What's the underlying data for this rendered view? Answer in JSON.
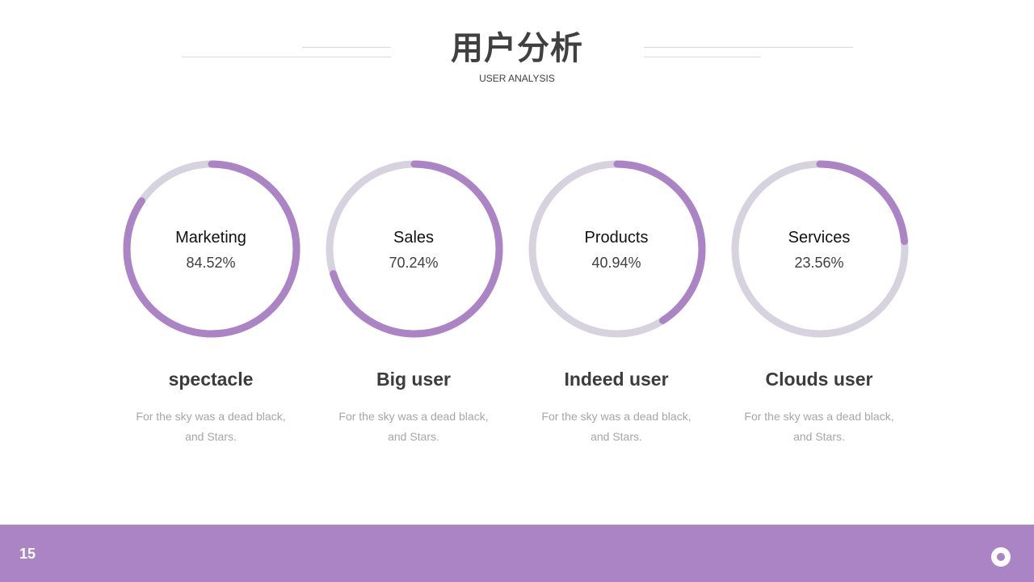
{
  "header": {
    "title": "用户分析",
    "subtitle": "USER ANALYSIS"
  },
  "items": [
    {
      "label": "Marketing",
      "value_text": "84.52%",
      "fraction": 0.8452,
      "heading": "spectacle",
      "desc_line1": "For the sky was a dead black,",
      "desc_line2": "and Stars."
    },
    {
      "label": "Sales",
      "value_text": "70.24%",
      "fraction": 0.7024,
      "heading": "Big user",
      "desc_line1": "For the sky was a dead black,",
      "desc_line2": "and Stars."
    },
    {
      "label": "Products",
      "value_text": "40.94%",
      "fraction": 0.4094,
      "heading": "Indeed user",
      "desc_line1": "For the sky was a dead black,",
      "desc_line2": "and Stars."
    },
    {
      "label": "Services",
      "value_text": "23.56%",
      "fraction": 0.2356,
      "heading": "Clouds user",
      "desc_line1": "For the sky was a dead black,",
      "desc_line2": "and Stars."
    }
  ],
  "footer": {
    "page_number": "15",
    "icon": "ring-icon"
  },
  "colors": {
    "accent": "#ab84c5",
    "track": "#d6d3de",
    "title": "#404040",
    "desc": "#a6a6a6"
  }
}
